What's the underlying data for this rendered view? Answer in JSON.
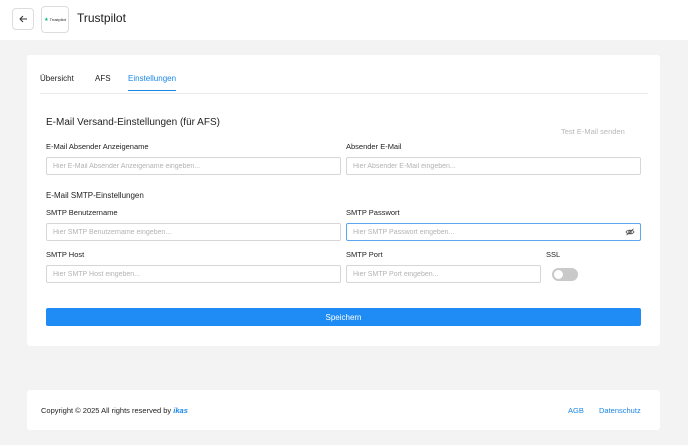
{
  "header": {
    "back_icon": "arrow-left-icon",
    "logo_text": "Trustpilot",
    "title": "Trustpilot"
  },
  "tabs": [
    {
      "label": "Übersicht",
      "active": false
    },
    {
      "label": "AFS",
      "active": false
    },
    {
      "label": "Einstellungen",
      "active": true
    }
  ],
  "email_settings": {
    "title": "E-Mail Versand-Einstellungen (für AFS)",
    "test_mail_label": "Test E-Mail senden",
    "sender_name": {
      "label": "E-Mail Absender Anzeigename",
      "placeholder": "Hier E-Mail Absender Anzeigename eingeben...",
      "value": ""
    },
    "sender_email": {
      "label": "Absender E-Mail",
      "placeholder": "Hier Absender E-Mail eingeben...",
      "value": ""
    }
  },
  "smtp": {
    "title": "E-Mail SMTP-Einstellungen",
    "username": {
      "label": "SMTP Benutzername",
      "placeholder": "Hier SMTP Benutzername eingeben...",
      "value": ""
    },
    "password": {
      "label": "SMTP Passwort",
      "placeholder": "Hier SMTP Passwort eingeben...",
      "value": "",
      "icon": "eye-off-icon"
    },
    "host": {
      "label": "SMTP Host",
      "placeholder": "Hier SMTP Host eingeben...",
      "value": ""
    },
    "port": {
      "label": "SMTP Port",
      "placeholder": "Hier SMTP Port eingeben...",
      "value": ""
    },
    "ssl": {
      "label": "SSL",
      "enabled": false
    }
  },
  "save_label": "Speichern",
  "footer": {
    "copyright_prefix": "Copyright © 2025 All rights reserved by",
    "brand": "ikas",
    "links": [
      "AGB",
      "Datenschutz"
    ]
  },
  "colors": {
    "accent": "#1f8cf5",
    "link": "#1a87e8",
    "background": "#f3f3f3",
    "trustpilot_star": "#00b67a"
  }
}
